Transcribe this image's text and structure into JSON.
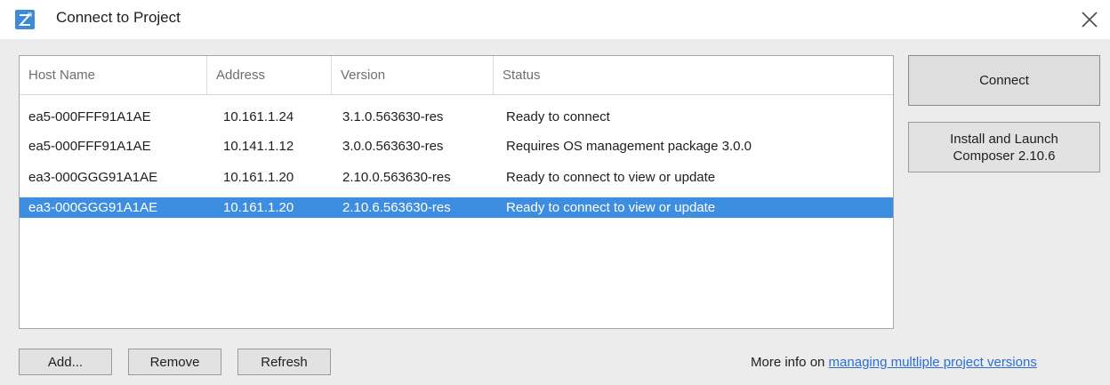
{
  "window": {
    "title": "Connect to Project",
    "icon": "project-app-icon",
    "close_icon": "close-icon"
  },
  "table": {
    "columns": [
      "Host Name",
      "Address",
      "Version",
      "Status"
    ],
    "rows": [
      {
        "host": "ea5-000FFF91A1AE",
        "address": "10.161.1.24",
        "version": "3.1.0.563630-res",
        "status": "Ready to connect",
        "selected": false
      },
      {
        "host": "ea5-000FFF91A1AE",
        "address": "10.141.1.12",
        "version": "3.0.0.563630-res",
        "status": "Requires OS management package 3.0.0",
        "selected": false
      },
      {
        "host": "ea3-000GGG91A1AE",
        "address": "10.161.1.20",
        "version": "2.10.0.563630-res",
        "status": "Ready to connect to view or update",
        "selected": false
      },
      {
        "host": "ea3-000GGG91A1AE",
        "address": "10.161.1.20",
        "version": "2.10.6.563630-res",
        "status": "Ready to connect to view or update",
        "selected": true
      }
    ]
  },
  "side_buttons": {
    "connect": "Connect",
    "install_line1": "Install and Launch",
    "install_line2": "Composer 2.10.6"
  },
  "bottom_buttons": {
    "add": "Add...",
    "remove": "Remove",
    "refresh": "Refresh"
  },
  "footer": {
    "text": "More info on ",
    "link": "managing multliple project versions"
  },
  "colors": {
    "selection": "#3d8ee0",
    "link": "#2b6fd4",
    "dialog_background": "#ececec"
  }
}
